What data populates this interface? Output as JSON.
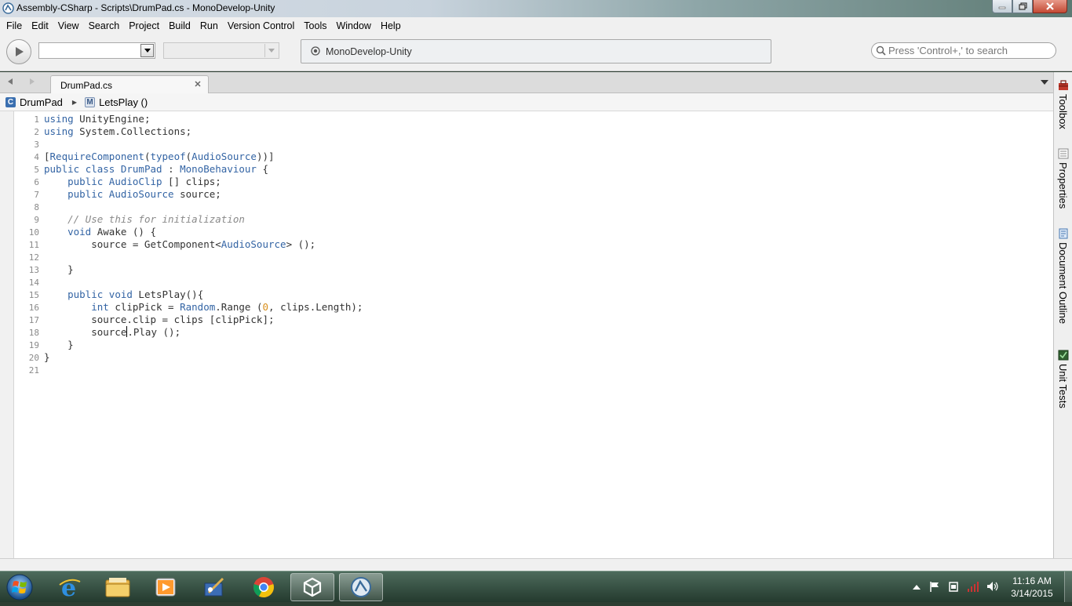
{
  "window": {
    "title": "Assembly-CSharp - Scripts\\DrumPad.cs - MonoDevelop-Unity"
  },
  "menu": [
    "File",
    "Edit",
    "View",
    "Search",
    "Project",
    "Build",
    "Run",
    "Version Control",
    "Tools",
    "Window",
    "Help"
  ],
  "toolbar": {
    "config_value": "",
    "target_value": "",
    "status_text": "MonoDevelop-Unity",
    "search_placeholder": "Press 'Control+,' to search"
  },
  "tabs": [
    {
      "label": "DrumPad.cs",
      "active": true
    }
  ],
  "breadcrumb": {
    "class_icon": "C",
    "class_name": "DrumPad",
    "method_icon": "M",
    "method_name": "LetsPlay ()"
  },
  "code_lines": [
    "using UnityEngine;",
    "using System.Collections;",
    "",
    "[RequireComponent(typeof(AudioSource))]",
    "public class DrumPad : MonoBehaviour {",
    "    public AudioClip [] clips;",
    "    public AudioSource source;",
    "",
    "    // Use this for initialization",
    "    void Awake () {",
    "        source = GetComponent<AudioSource> ();",
    "",
    "    }",
    "",
    "    public void LetsPlay(){",
    "        int clipPick = Random.Range (0, clips.Length);",
    "        source.clip = clips [clipPick];",
    "        source.Play ();",
    "    }",
    "}",
    ""
  ],
  "caret": {
    "line": 18,
    "column": 14
  },
  "dock": [
    "Toolbox",
    "Properties",
    "Document Outline",
    "Unit Tests"
  ],
  "taskbar": {
    "apps": [
      "internet-explorer",
      "file-explorer",
      "media-player",
      "tool-app",
      "chrome",
      "unity",
      "monodevelop"
    ],
    "time": "11:16 AM",
    "date": "3/14/2015"
  },
  "colors": {
    "keyword": "#3364a4",
    "comment": "#8a8a8a",
    "number": "#d9901d",
    "text": "#333333"
  }
}
